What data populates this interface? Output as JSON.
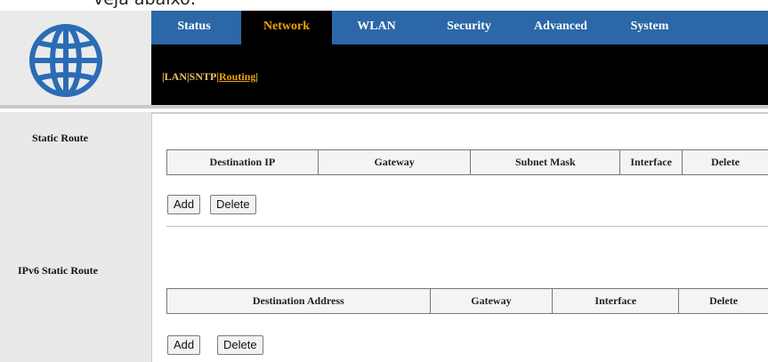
{
  "caption": "veja abaixo:",
  "nav": {
    "tabs": [
      {
        "label": "Status"
      },
      {
        "label": "Network"
      },
      {
        "label": "WLAN"
      },
      {
        "label": "Security"
      },
      {
        "label": "Advanced"
      },
      {
        "label": "System"
      }
    ],
    "active_tab": "Network"
  },
  "subnav": {
    "sep_left": "|",
    "lan": "LAN",
    "sep1": "|",
    "sntp": "SNTP",
    "sep2": "|",
    "routing": "Routing",
    "sep_right": "|"
  },
  "sections": {
    "static_route": {
      "title": "Static Route",
      "columns": [
        "Destination IP",
        "Gateway",
        "Subnet Mask",
        "Interface",
        "Delete"
      ],
      "add_label": "Add",
      "delete_label": "Delete"
    },
    "ipv6_static_route": {
      "title": "IPv6 Static Route",
      "columns": [
        "Destination Address",
        "Gateway",
        "Interface",
        "Delete"
      ],
      "add_label": "Add",
      "delete_label": "Delete"
    }
  },
  "colors": {
    "nav_blue": "#2c67a7",
    "active_tab_text": "#f0a30a",
    "logo_blue": "#2a6cb5"
  },
  "icons": {
    "logo": "globe-icon"
  }
}
